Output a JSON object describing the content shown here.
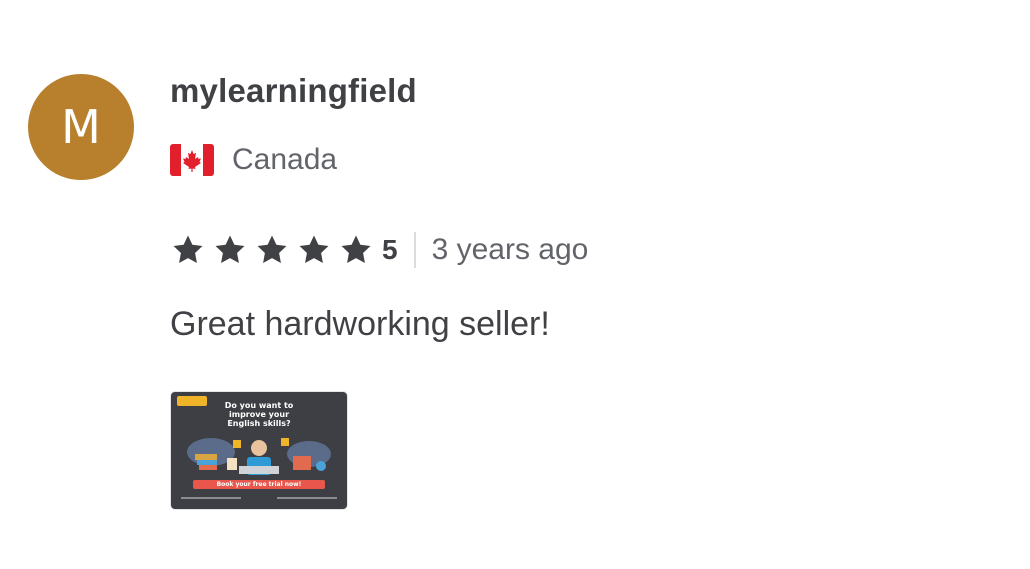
{
  "reviewer": {
    "avatar_initial": "M",
    "avatar_color": "#b87f2c",
    "username": "mylearningfield",
    "country": "Canada",
    "flag_icon": "canada-flag-icon"
  },
  "rating": {
    "stars": 5,
    "score_label": "5",
    "star_color": "#404145",
    "time_ago": "3 years ago"
  },
  "review": {
    "text": "Great hardworking seller!"
  },
  "attachment": {
    "headline": "Do you want to improve your English skills?",
    "cta": "Book your free trial now!"
  }
}
